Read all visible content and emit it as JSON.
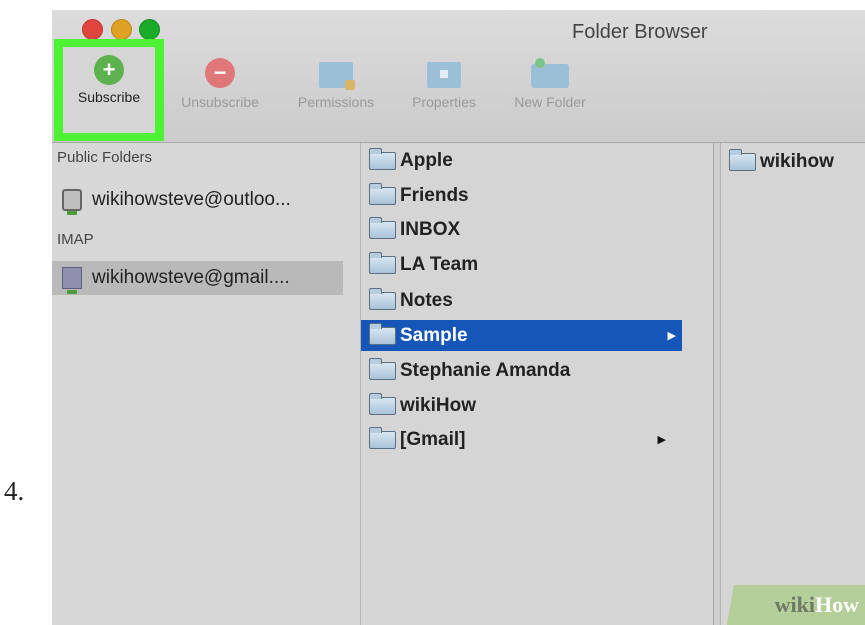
{
  "step_number": "4.",
  "window": {
    "title": "Folder Browser"
  },
  "toolbar": {
    "subscribe": "Subscribe",
    "unsubscribe": "Unsubscribe",
    "permissions": "Permissions",
    "properties": "Properties",
    "new_folder": "New Folder"
  },
  "sidebar": {
    "public_folders_header": "Public Folders",
    "public_account": "wikihowsteve@outloo...",
    "imap_header": "IMAP",
    "imap_account": "wikihowsteve@gmail...."
  },
  "folders": {
    "items": [
      {
        "name": "Apple"
      },
      {
        "name": "Friends"
      },
      {
        "name": "INBOX"
      },
      {
        "name": "LA Team"
      },
      {
        "name": "Notes"
      },
      {
        "name": "Sample"
      },
      {
        "name": "Stephanie Amanda"
      },
      {
        "name": "wikiHow"
      },
      {
        "name": "[Gmail]"
      }
    ],
    "selected": "Sample"
  },
  "subfolders": {
    "items": [
      {
        "name": "wikihow"
      }
    ]
  },
  "watermark": {
    "part1": "wiki",
    "part2": "How"
  },
  "colors": {
    "highlight": "#4cf233",
    "selection": "#1656b8"
  }
}
